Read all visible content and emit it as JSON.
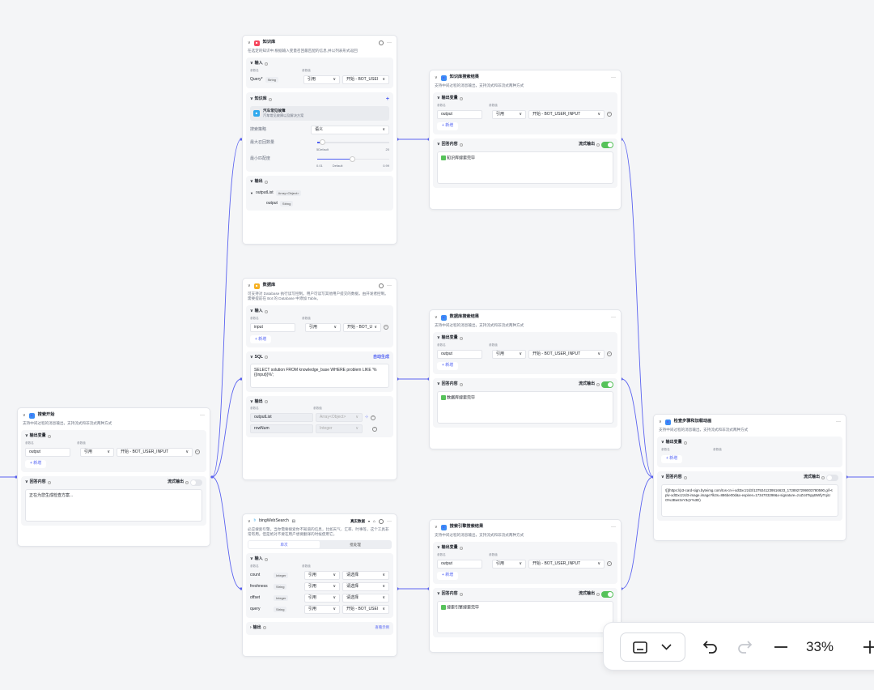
{
  "common": {
    "input_label": "输入",
    "output_label": "输出",
    "output_var_label": "输出变量",
    "reply_label": "回答内容",
    "stream_label": "流式输出",
    "add_label": "+ 新增",
    "param_name_hdr": "参数名",
    "param_value_hdr": "参数值",
    "ref_label": "引用",
    "ref_chev": "∨",
    "user_input": "开始 - BOT_USER_INPUT",
    "user_input_short": "开始 - BOT_USEI",
    "user_input_short2": "开始 - BOT_U",
    "choose": "请选择",
    "stream_desc": "支持中间过程的消息输出，支持流式和非流式两种方式"
  },
  "kb_node": {
    "title": "知识库",
    "desc": "在选定的知识中,根据输入变量召回最匹配的信息,并以列表形式返回",
    "query_label": "Query*",
    "query_type": "String",
    "kb_section": "知识库",
    "kb_item_title": "汽车常见故障",
    "kb_item_sub": "汽车常见故障以及解决方案",
    "search_strategy_label": "搜索策略",
    "search_strategy_value": "语义",
    "max_recall_label": "最大召回数量",
    "max_recall_min": "1",
    "max_recall_default": "5Default",
    "max_recall_max": "20",
    "min_score_label": "最小匹配度",
    "min_score_min": "0.01",
    "min_score_default": "Default",
    "min_score_max": "0.99",
    "out_list": "outputList",
    "out_list_type": "Array<Object>",
    "out_item": "output",
    "out_item_type": "String"
  },
  "kb_result": {
    "title": "知识库搜索结果",
    "var_name": "output",
    "reply": "知识库搜索完毕"
  },
  "db_node": {
    "title": "数据库",
    "desc": "可支持对 Database 执行读写控制。用户可读写其他用户提交的数据，由开发者控制。需要提前在 Bot 的 Database 中添加 Table。",
    "var_name": "input",
    "sql_label": "SQL",
    "auto_gen": "自动生成",
    "sql_text": "SELECT solution FROM knowledge_base WHERE problem LIKE '%{{input}}%';",
    "out1": "outputList",
    "out1_type": "Array<Object>",
    "out2": "rowNum",
    "out2_type": "Integer"
  },
  "db_result": {
    "title": "数据库搜索结果",
    "var_name": "output",
    "reply": "数据库搜索完毕"
  },
  "start_msg": {
    "title": "搜索开始",
    "var_name": "output",
    "reply": "正在为您生成检查方案..."
  },
  "bing_node": {
    "title": "bingWebSearch",
    "badge": "真实数据",
    "desc": "必应搜索引擎。当你需要搜索你不知道的信息，比如天气、汇率、时事等，这个工具非常有用。但是绝对不要在用户想要翻译的时候使用它。",
    "tab1": "单次",
    "tab2": "批处理",
    "params": [
      {
        "name": "count",
        "type": "Integer",
        "mode": "引用",
        "value": "请选择"
      },
      {
        "name": "freshness",
        "type": "String",
        "mode": "引用",
        "value": "请选择"
      },
      {
        "name": "offset",
        "type": "Integer",
        "mode": "引用",
        "value": "请选择"
      },
      {
        "name": "query",
        "type": "String",
        "mode": "引用",
        "value": "开始 - BOT_USEI"
      }
    ],
    "example": "查看示例"
  },
  "bing_result": {
    "title": "搜索引擎搜索结果",
    "var_name": "output",
    "reply": "搜索引擎搜索完毕"
  },
  "final_node": {
    "title": "检查步骤和加载动画",
    "reply": "![](https://p3-card-sign.byteimg.com/tos-cn-i-xdt3xczzd3/1379241239516633_1728927299003780590.gif~tplv-xdt3xczzd3-image.image?lk3s=886be00d&x-expires=1734703298&x-signature=zoZ44TspyBWfyTqiUO%2Bwr2vY3qY%3D)"
  },
  "toolbar": {
    "zoom": "33%"
  }
}
